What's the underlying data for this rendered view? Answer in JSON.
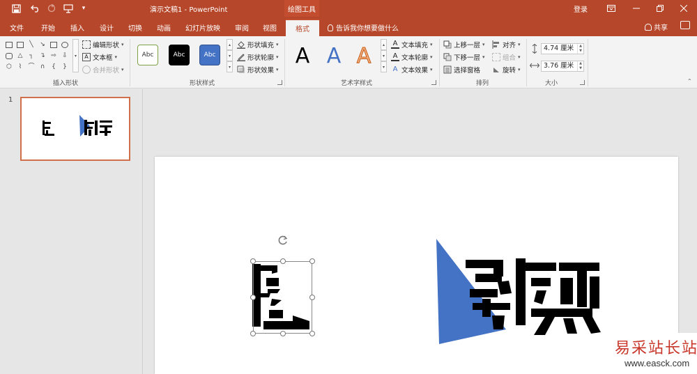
{
  "app": {
    "doc_title": "演示文稿1  -  PowerPoint",
    "context_tab_group": "绘图工具",
    "login": "登录"
  },
  "tabs": [
    "文件",
    "开始",
    "插入",
    "设计",
    "切换",
    "动画",
    "幻灯片放映",
    "审阅",
    "视图"
  ],
  "active_tab": "格式",
  "tell_me": "告诉我你想要做什么",
  "share": "共享",
  "ribbon": {
    "insert_shapes": {
      "label": "插入形状",
      "edit_shape": "编辑形状",
      "text_box": "文本框",
      "merge_shapes": "合并形状"
    },
    "shape_styles": {
      "label": "形状样式",
      "swatches": [
        "Abc",
        "Abc",
        "Abc"
      ],
      "fill": "形状填充",
      "outline": "形状轮廓",
      "effects": "形状效果"
    },
    "wordart_styles": {
      "label": "艺术字样式",
      "letters": [
        "A",
        "A",
        "A"
      ],
      "text_fill": "文本填充",
      "text_outline": "文本轮廓",
      "text_effects": "文本效果"
    },
    "arrange": {
      "label": "排列",
      "bring_forward": "上移一层",
      "send_backward": "下移一层",
      "selection_pane": "选择窗格",
      "align": "对齐",
      "group": "组合",
      "rotate": "旋转"
    },
    "size": {
      "label": "大小",
      "height": "4.74 厘米",
      "width": "3.76 厘米"
    }
  },
  "slides_panel": {
    "slide_number": "1"
  },
  "slide": {
    "words": [
      "撕裂"
    ],
    "accent_color": "#4472c4"
  },
  "watermark": {
    "cn": "易采站长站",
    "url": "www.easck.com"
  },
  "colors": {
    "brand": "#b7472a",
    "ribbon_bg": "#f3f3f3",
    "accent_blue": "#4472c4",
    "thumb_border": "#d0704b"
  }
}
